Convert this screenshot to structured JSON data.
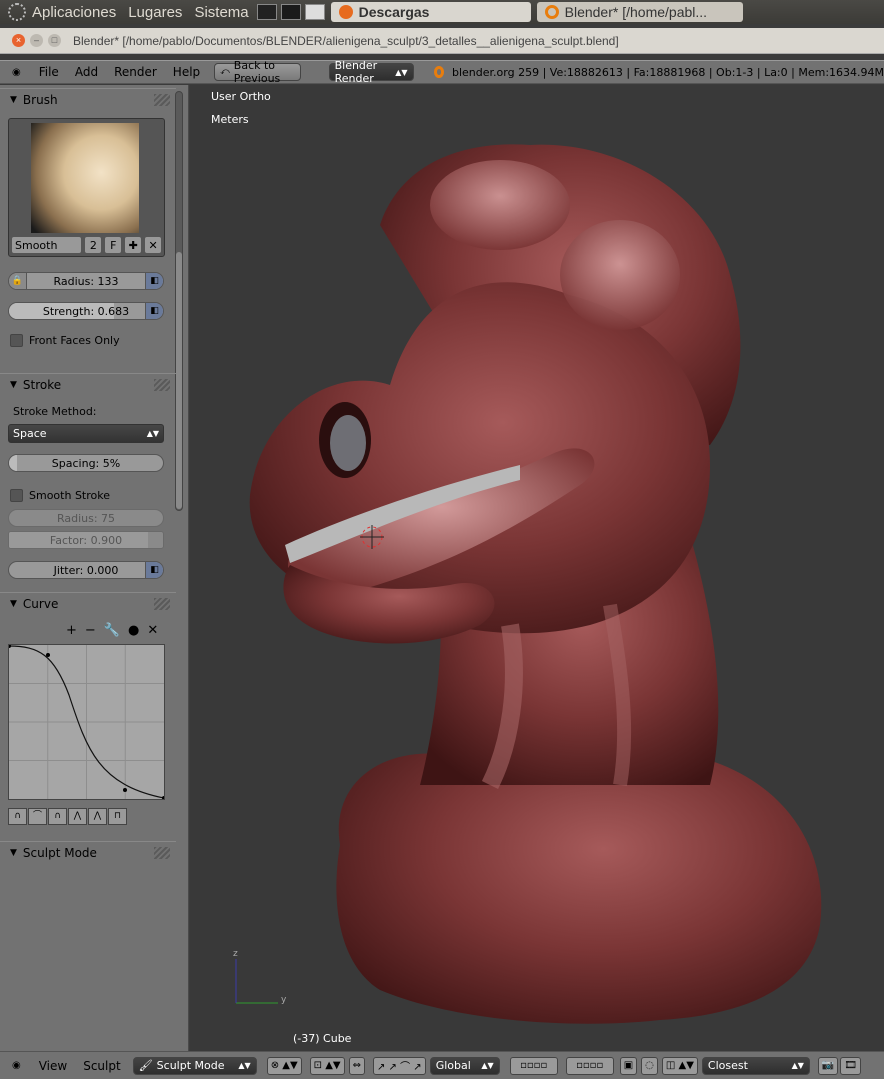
{
  "taskbar": {
    "menus": [
      "Aplicaciones",
      "Lugares",
      "Sistema"
    ],
    "tasks": [
      {
        "label": "Descargas",
        "active": true
      },
      {
        "label": "Blender* [/home/pabl...",
        "active": false
      }
    ]
  },
  "window": {
    "title": "Blender*  [/home/pablo/Documentos/BLENDER/alienigena_sculpt/3_detalles__alienigena_sculpt.blend]"
  },
  "info_header": {
    "menus": [
      "File",
      "Add",
      "Render",
      "Help"
    ],
    "back_button": "Back to Previous",
    "render_engine": "Blender Render",
    "stats": "blender.org 259 | Ve:18882613 | Fa:18881968 | Ob:1-3 | La:0 | Mem:1634.94M"
  },
  "toolbar": {
    "brush": {
      "header": "Brush",
      "name": "Smooth",
      "users": "2",
      "fake_user": "F",
      "radius": "Radius: 133",
      "strength": "Strength: 0.683",
      "strength_value": 0.683,
      "front_faces": "Front Faces Only"
    },
    "stroke": {
      "header": "Stroke",
      "method_label": "Stroke Method:",
      "method": "Space",
      "spacing": "Spacing: 5%",
      "spacing_value": 0.05,
      "smooth_stroke": "Smooth Stroke",
      "smooth_radius": "Radius: 75",
      "smooth_factor": "Factor: 0.900",
      "smooth_factor_value": 0.9,
      "jitter": "Jitter: 0.000"
    },
    "curve": {
      "header": "Curve",
      "tools": [
        "+",
        "−",
        "wrench",
        "●",
        "×"
      ]
    },
    "sculpt_mode_header": "Sculpt Mode"
  },
  "viewport": {
    "view_name": "User Ortho",
    "units": "Meters",
    "object_info": "(-37) Cube",
    "axis_y": "y",
    "axis_z": "z"
  },
  "footer": {
    "menus": [
      "View",
      "Sculpt"
    ],
    "mode": "Sculpt Mode",
    "orientation": "Global",
    "snap": "Closest"
  },
  "colors": {
    "panel_bg": "#727272",
    "viewport_bg": "#393939",
    "model": "#7a3535"
  }
}
